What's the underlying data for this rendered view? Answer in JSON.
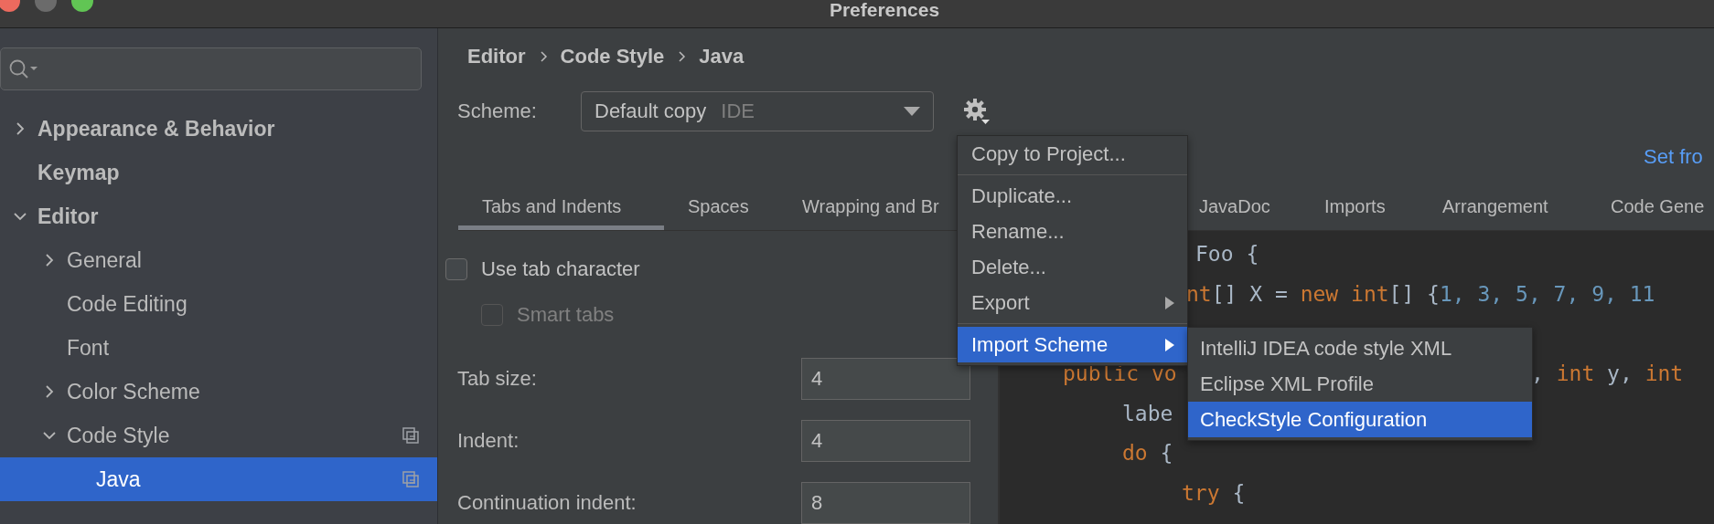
{
  "window": {
    "title": "Preferences"
  },
  "sidebar": {
    "items": [
      {
        "label": "Appearance & Behavior",
        "expanded": false,
        "selected": false,
        "scheme_icon": false
      },
      {
        "label": "Keymap",
        "selected": false,
        "scheme_icon": false
      },
      {
        "label": "Editor",
        "expanded": true,
        "selected": false,
        "scheme_icon": false,
        "children": [
          {
            "label": "General",
            "expanded": false,
            "selected": false,
            "scheme_icon": false
          },
          {
            "label": "Code Editing",
            "selected": false,
            "scheme_icon": false
          },
          {
            "label": "Font",
            "selected": false,
            "scheme_icon": false
          },
          {
            "label": "Color Scheme",
            "expanded": false,
            "selected": false,
            "scheme_icon": false
          },
          {
            "label": "Code Style",
            "expanded": true,
            "selected": false,
            "scheme_icon": true,
            "children": [
              {
                "label": "Java",
                "selected": true,
                "scheme_icon": true
              }
            ]
          }
        ]
      }
    ]
  },
  "breadcrumb": [
    "Editor",
    "Code Style",
    "Java"
  ],
  "scheme": {
    "label": "Scheme:",
    "value": "Default copy",
    "scope": "IDE"
  },
  "link": "Set fro",
  "tabs": [
    {
      "label": "Tabs and Indents",
      "selected": true
    },
    {
      "label": "Spaces",
      "selected": false
    },
    {
      "label": "Wrapping and Br",
      "selected": false
    },
    {
      "label": "JavaDoc",
      "selected": false
    },
    {
      "label": "Imports",
      "selected": false
    },
    {
      "label": "Arrangement",
      "selected": false
    },
    {
      "label": "Code Gene",
      "selected": false
    }
  ],
  "options": [
    {
      "label": "Use tab character",
      "checked": false,
      "disabled": false,
      "children": [
        {
          "label": "Smart tabs",
          "checked": false,
          "disabled": true
        }
      ]
    }
  ],
  "fields": [
    {
      "label": "Tab size:",
      "value": "4"
    },
    {
      "label": "Indent:",
      "value": "4"
    },
    {
      "label": "Continuation indent:",
      "value": "8"
    }
  ],
  "preview": {
    "lines": [
      {
        "fragments": [
          [
            {
              "kind": "plain",
              "text": "Foo {"
            }
          ]
        ]
      },
      {
        "fragments": [
          [
            {
              "kind": "keyword",
              "text": "nt"
            },
            {
              "kind": "plain",
              "text": "[] X = "
            },
            {
              "kind": "keyword",
              "text": "new int"
            },
            {
              "kind": "plain",
              "text": "[] {"
            },
            {
              "kind": "number",
              "text": "1, 3, 5, 7, 9, 11"
            }
          ]
        ]
      },
      {
        "fragments": [
          [
            {
              "kind": "keyword",
              "text": "public vo"
            }
          ],
          [
            {
              "kind": "plain",
              "text": ", "
            },
            {
              "kind": "keyword",
              "text": "int"
            },
            {
              "kind": "plain",
              "text": " y, "
            },
            {
              "kind": "keyword",
              "text": "int"
            }
          ]
        ]
      },
      {
        "fragments": [
          [
            {
              "kind": "plain",
              "text": "labe"
            }
          ]
        ]
      },
      {
        "fragments": [
          [
            {
              "kind": "keyword",
              "text": "do"
            },
            {
              "kind": "plain",
              "text": " {"
            }
          ]
        ]
      },
      {
        "fragments": [
          [
            {
              "kind": "keyword",
              "text": "try"
            },
            {
              "kind": "plain",
              "text": " {"
            }
          ]
        ]
      }
    ]
  },
  "menu": {
    "items": [
      {
        "kind": "item",
        "label": "Copy to Project...",
        "selected": false,
        "has_submenu": false
      },
      {
        "kind": "separator"
      },
      {
        "kind": "item",
        "label": "Duplicate...",
        "selected": false,
        "has_submenu": false
      },
      {
        "kind": "item",
        "label": "Rename...",
        "selected": false,
        "has_submenu": false
      },
      {
        "kind": "item",
        "label": "Delete...",
        "selected": false,
        "has_submenu": false
      },
      {
        "kind": "item",
        "label": "Export",
        "selected": false,
        "has_submenu": true
      },
      {
        "kind": "separator"
      },
      {
        "kind": "item",
        "label": "Import Scheme",
        "selected": true,
        "has_submenu": true,
        "children": [
          {
            "label": "IntelliJ IDEA code style XML",
            "selected": false
          },
          {
            "label": "Eclipse XML Profile",
            "selected": false
          },
          {
            "label": "CheckStyle Configuration",
            "selected": true
          }
        ]
      }
    ]
  }
}
